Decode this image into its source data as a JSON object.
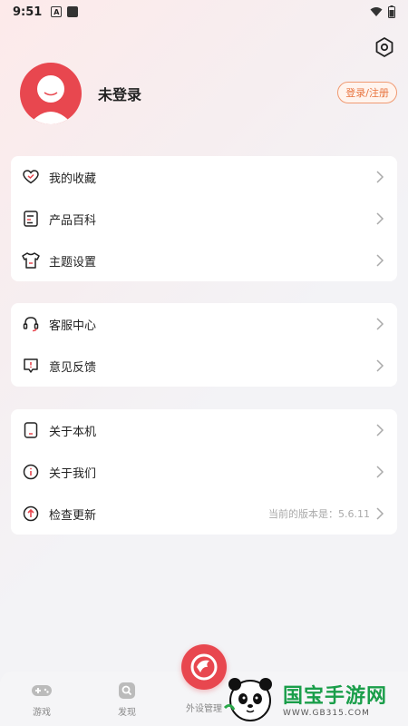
{
  "status_bar": {
    "time": "9:51"
  },
  "profile": {
    "name": "未登录",
    "login_label": "登录/注册"
  },
  "menu_group1": [
    {
      "label": "我的收藏",
      "icon": "heart-icon"
    },
    {
      "label": "产品百科",
      "icon": "document-icon"
    },
    {
      "label": "主题设置",
      "icon": "tshirt-icon"
    }
  ],
  "menu_group2": [
    {
      "label": "客服中心",
      "icon": "headset-icon"
    },
    {
      "label": "意见反馈",
      "icon": "feedback-icon"
    }
  ],
  "menu_group3": [
    {
      "label": "关于本机",
      "icon": "device-icon"
    },
    {
      "label": "关于我们",
      "icon": "info-icon"
    },
    {
      "label": "检查更新",
      "icon": "update-icon",
      "extra": "当前的版本是：5.6.11"
    }
  ],
  "bottom_nav": [
    {
      "label": "游戏",
      "icon": "gamepad-icon"
    },
    {
      "label": "发现",
      "icon": "discover-icon"
    },
    {
      "label": "外设管理",
      "icon": "brand-icon"
    }
  ],
  "watermark": {
    "title": "国宝手游网",
    "url": "WWW.GB315.COM"
  },
  "colors": {
    "accent": "#e8474f",
    "login_border": "#f09a72",
    "watermark_green": "#1a9e4a"
  }
}
